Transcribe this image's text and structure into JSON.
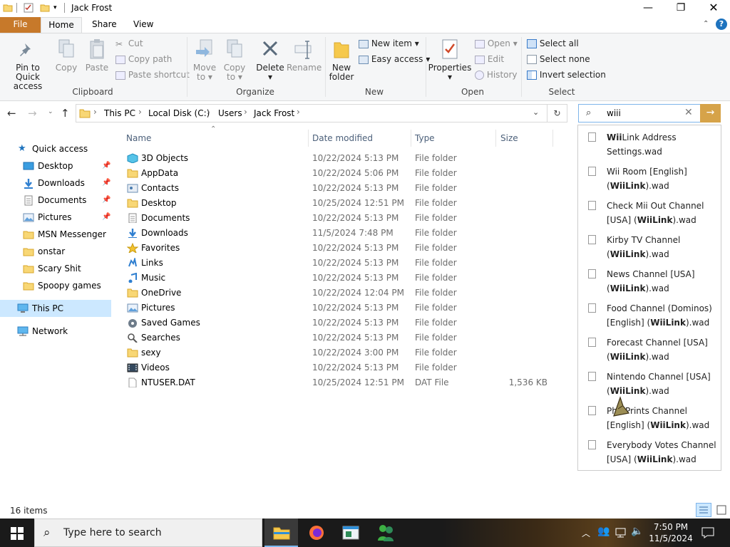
{
  "window": {
    "title": "Jack Frost"
  },
  "tabs": [
    {
      "label": "File"
    },
    {
      "label": "Home"
    },
    {
      "label": "Share"
    },
    {
      "label": "View"
    }
  ],
  "ribbon": {
    "clipboard": {
      "group_label": "Clipboard",
      "pin_line1": "Pin to Quick",
      "pin_line2": "access",
      "copy": "Copy",
      "paste": "Paste",
      "cut": "Cut",
      "copy_path": "Copy path",
      "paste_shortcut": "Paste shortcut"
    },
    "organize": {
      "group_label": "Organize",
      "move_to_1": "Move",
      "move_to_2": "to",
      "copy_to_1": "Copy",
      "copy_to_2": "to",
      "delete": "Delete",
      "rename": "Rename"
    },
    "new": {
      "group_label": "New",
      "new_folder_1": "New",
      "new_folder_2": "folder",
      "new_item": "New item",
      "easy_access": "Easy access"
    },
    "open": {
      "group_label": "Open",
      "properties": "Properties",
      "open": "Open",
      "edit": "Edit",
      "history": "History"
    },
    "select": {
      "group_label": "Select",
      "select_all": "Select all",
      "select_none": "Select none",
      "invert_selection": "Invert selection"
    }
  },
  "address": {
    "crumbs": [
      "This PC",
      "Local Disk (C:)",
      "Users",
      "Jack Frost"
    ]
  },
  "search": {
    "value": "wiii"
  },
  "sidebar": {
    "quick_access": "Quick access",
    "items": [
      {
        "label": "Desktop",
        "pinned": true
      },
      {
        "label": "Downloads",
        "pinned": true
      },
      {
        "label": "Documents",
        "pinned": true
      },
      {
        "label": "Pictures",
        "pinned": true
      },
      {
        "label": "MSN Messenger",
        "pinned": false
      },
      {
        "label": "onstar",
        "pinned": false
      },
      {
        "label": "Scary Shit",
        "pinned": false
      },
      {
        "label": "Spoopy games",
        "pinned": false
      }
    ],
    "this_pc": "This PC",
    "network": "Network"
  },
  "columns": {
    "name": "Name",
    "date": "Date modified",
    "type": "Type",
    "size": "Size"
  },
  "files": [
    {
      "name": "3D Objects",
      "date": "10/22/2024 5:13 PM",
      "type": "File folder",
      "size": "",
      "icon": "3d-objects-icon"
    },
    {
      "name": "AppData",
      "date": "10/22/2024 5:06 PM",
      "type": "File folder",
      "size": "",
      "icon": "folder-icon"
    },
    {
      "name": "Contacts",
      "date": "10/22/2024 5:13 PM",
      "type": "File folder",
      "size": "",
      "icon": "contacts-icon"
    },
    {
      "name": "Desktop",
      "date": "10/25/2024 12:51 PM",
      "type": "File folder",
      "size": "",
      "icon": "folder-icon"
    },
    {
      "name": "Documents",
      "date": "10/22/2024 5:13 PM",
      "type": "File folder",
      "size": "",
      "icon": "documents-icon"
    },
    {
      "name": "Downloads",
      "date": "11/5/2024 7:48 PM",
      "type": "File folder",
      "size": "",
      "icon": "downloads-icon"
    },
    {
      "name": "Favorites",
      "date": "10/22/2024 5:13 PM",
      "type": "File folder",
      "size": "",
      "icon": "star-icon"
    },
    {
      "name": "Links",
      "date": "10/22/2024 5:13 PM",
      "type": "File folder",
      "size": "",
      "icon": "links-icon"
    },
    {
      "name": "Music",
      "date": "10/22/2024 5:13 PM",
      "type": "File folder",
      "size": "",
      "icon": "music-icon"
    },
    {
      "name": "OneDrive",
      "date": "10/22/2024 12:04 PM",
      "type": "File folder",
      "size": "",
      "icon": "folder-icon"
    },
    {
      "name": "Pictures",
      "date": "10/22/2024 5:13 PM",
      "type": "File folder",
      "size": "",
      "icon": "pictures-icon"
    },
    {
      "name": "Saved Games",
      "date": "10/22/2024 5:13 PM",
      "type": "File folder",
      "size": "",
      "icon": "saved-games-icon"
    },
    {
      "name": "Searches",
      "date": "10/22/2024 5:13 PM",
      "type": "File folder",
      "size": "",
      "icon": "searches-icon"
    },
    {
      "name": "sexy",
      "date": "10/22/2024 3:00 PM",
      "type": "File folder",
      "size": "",
      "icon": "folder-icon"
    },
    {
      "name": "Videos",
      "date": "10/22/2024 5:13 PM",
      "type": "File folder",
      "size": "",
      "icon": "videos-icon"
    },
    {
      "name": "NTUSER.DAT",
      "date": "10/25/2024 12:51 PM",
      "type": "DAT File",
      "size": "1,536 KB",
      "icon": "file-icon"
    }
  ],
  "suggestions": [
    {
      "l1a": "Wii",
      "l1b": "Link Address",
      "l2a": "Settings.wad",
      "l2b": ""
    },
    {
      "l1a": "Wii Room [English]",
      "l1b": "",
      "l2a": "(",
      "l2b": "WiiLink",
      "l2c": ").wad"
    },
    {
      "l1a": "Check Mii Out Channel",
      "l1b": "",
      "l2a": "[USA] (",
      "l2b": "WiiLink",
      "l2c": ").wad"
    },
    {
      "l1a": "Kirby TV Channel",
      "l1b": "",
      "l2a": "(",
      "l2b": "WiiLink",
      "l2c": ").wad"
    },
    {
      "l1a": "News Channel [USA]",
      "l1b": "",
      "l2a": "(",
      "l2b": "WiiLink",
      "l2c": ").wad"
    },
    {
      "l1a": "Food Channel (Dominos)",
      "l1b": "",
      "l2a": "[English] (",
      "l2b": "WiiLink",
      "l2c": ").wad"
    },
    {
      "l1a": "Forecast Channel [USA]",
      "l1b": "",
      "l2a": "(",
      "l2b": "WiiLink",
      "l2c": ").wad"
    },
    {
      "l1a": "Nintendo Channel [USA]",
      "l1b": "",
      "l2a": "(",
      "l2b": "WiiLink",
      "l2c": ").wad"
    },
    {
      "l1a": "Ph",
      "l1b": "o Prints Channel",
      "l2a": "[English] (",
      "l2b": "WiiLink",
      "l2c": ").wad"
    },
    {
      "l1a": "Everybody Votes Channel",
      "l1b": "",
      "l2a": "[USA] (",
      "l2b": "WiiLink",
      "l2c": ").wad"
    }
  ],
  "status": {
    "item_count": "16 items"
  },
  "taskbar": {
    "search_placeholder": "Type here to search",
    "time": "7:50 PM",
    "date": "11/5/2024"
  },
  "colors": {
    "file_tab": "#c7792a",
    "search_go": "#d6a349",
    "selected_nav": "#cce8ff"
  }
}
